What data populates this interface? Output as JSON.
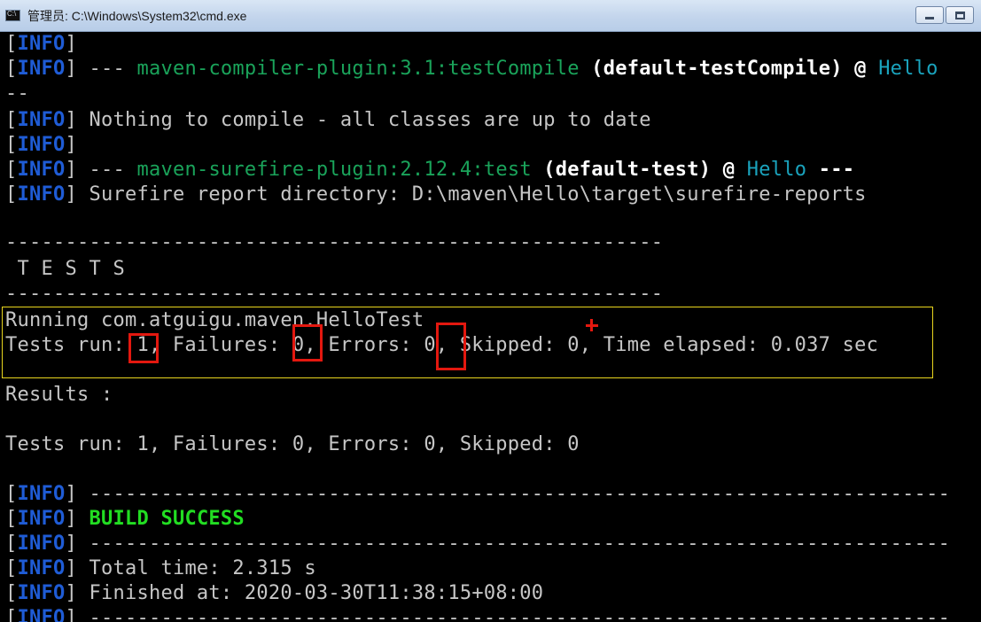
{
  "window": {
    "title": "管理员: C:\\Windows\\System32\\cmd.exe",
    "icon": "console-icon",
    "minimize_icon": "minimize-icon",
    "maximize_icon": "maximize-icon"
  },
  "console": {
    "colors": {
      "background": "#000000",
      "text": "#c6c6c6",
      "info": "#1f5cd6",
      "plugin": "#1aa35a",
      "project": "#1aa3bd",
      "success": "#22dd22",
      "highlight_box": "#e8d51e",
      "annotation_box": "#e3180f"
    },
    "info_tag": "INFO",
    "lines": {
      "l1_rest": "",
      "l2_dash": " --- ",
      "l2_plugin": "maven-compiler-plugin:3.1:testCompile",
      "l2_goal": " (default-testCompile) @ ",
      "l2_project": "Hello",
      "l3_text": "--",
      "l4_rest": " Nothing to compile - all classes are up to date",
      "l6_dash": " --- ",
      "l6_plugin": "maven-surefire-plugin:2.12.4:test",
      "l6_goal": " (default-test) @ ",
      "l6_project": "Hello",
      "l6_end": " ---",
      "l7_rest": " Surefire report directory: D:\\maven\\Hello\\target\\surefire-reports",
      "sep_short": "-------------------------------------------------------",
      "tests_header": " T E S T S",
      "running": "Running com.atguigu.maven.HelloTest",
      "tests_run_line": "Tests run: 1, Failures: 0, Errors: 0, Skipped: 0, Time elapsed: 0.037 sec",
      "results": "Results :",
      "summary": "Tests run: 1, Failures: 0, Errors: 0, Skipped: 0",
      "sep_long": " ------------------------------------------------------------------------",
      "build_success": "BUILD SUCCESS",
      "total_time": " Total time: 2.315 s",
      "finished_at": " Finished at: 2020-03-30T11:38:15+08:00"
    }
  }
}
